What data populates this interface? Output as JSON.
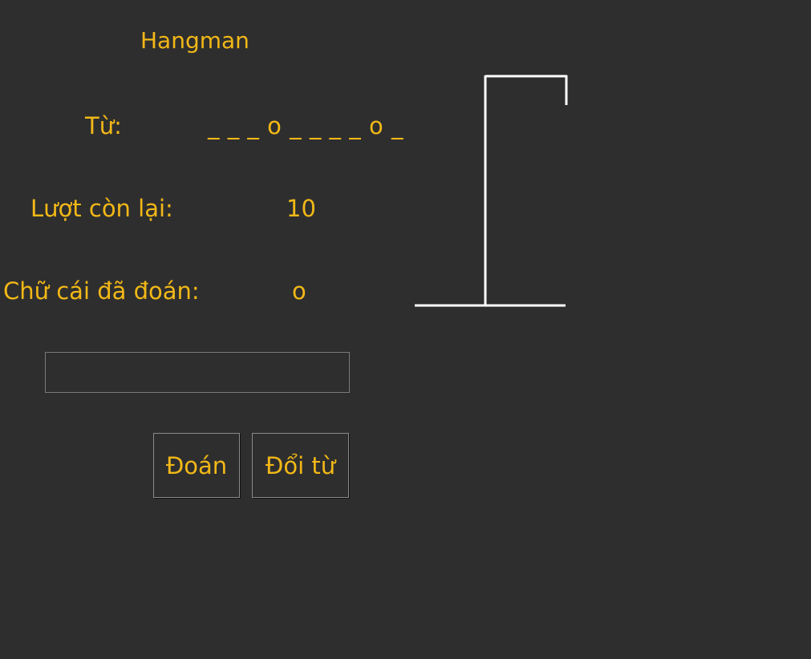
{
  "app": {
    "title": "Hangman"
  },
  "word": {
    "label": "Từ:",
    "masked": "_ _ _ o _ _ _ _ o _"
  },
  "turns": {
    "label": "Lượt còn lại:",
    "value": "10"
  },
  "guessed": {
    "label": "Chữ cái đã đoán:",
    "value": "o"
  },
  "input": {
    "value": "",
    "placeholder": ""
  },
  "buttons": {
    "guess_label": "Đoán",
    "change_word_label": "Đổi từ"
  },
  "colors": {
    "background": "#2e2e2e",
    "text": "#f2b817",
    "gallows": "#ffffff"
  }
}
